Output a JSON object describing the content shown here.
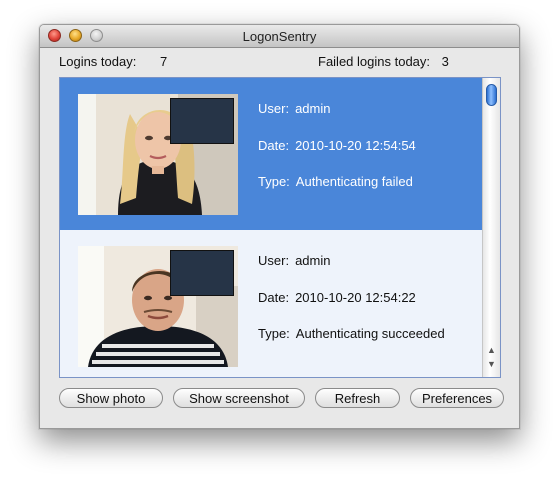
{
  "window": {
    "title": "LogonSentry"
  },
  "stats": {
    "logins_label": "Logins today:",
    "logins_value": "7",
    "failed_label": "Failed logins today:",
    "failed_value": "3"
  },
  "entries": [
    {
      "user_label": "User:",
      "user": "admin",
      "date_label": "Date:",
      "date": "2010-10-20 12:54:54",
      "type_label": "Type:",
      "type": "Authenticating failed",
      "selected": true
    },
    {
      "user_label": "User:",
      "user": "admin",
      "date_label": "Date:",
      "date": "2010-10-20 12:54:22",
      "type_label": "Type:",
      "type": "Authenticating succeeded",
      "selected": false
    }
  ],
  "buttons": {
    "show_photo": "Show photo",
    "show_screenshot": "Show screenshot",
    "refresh": "Refresh",
    "preferences": "Preferences"
  },
  "colors": {
    "selection": "#4a86d9",
    "list_bg": "#eef3fb"
  }
}
